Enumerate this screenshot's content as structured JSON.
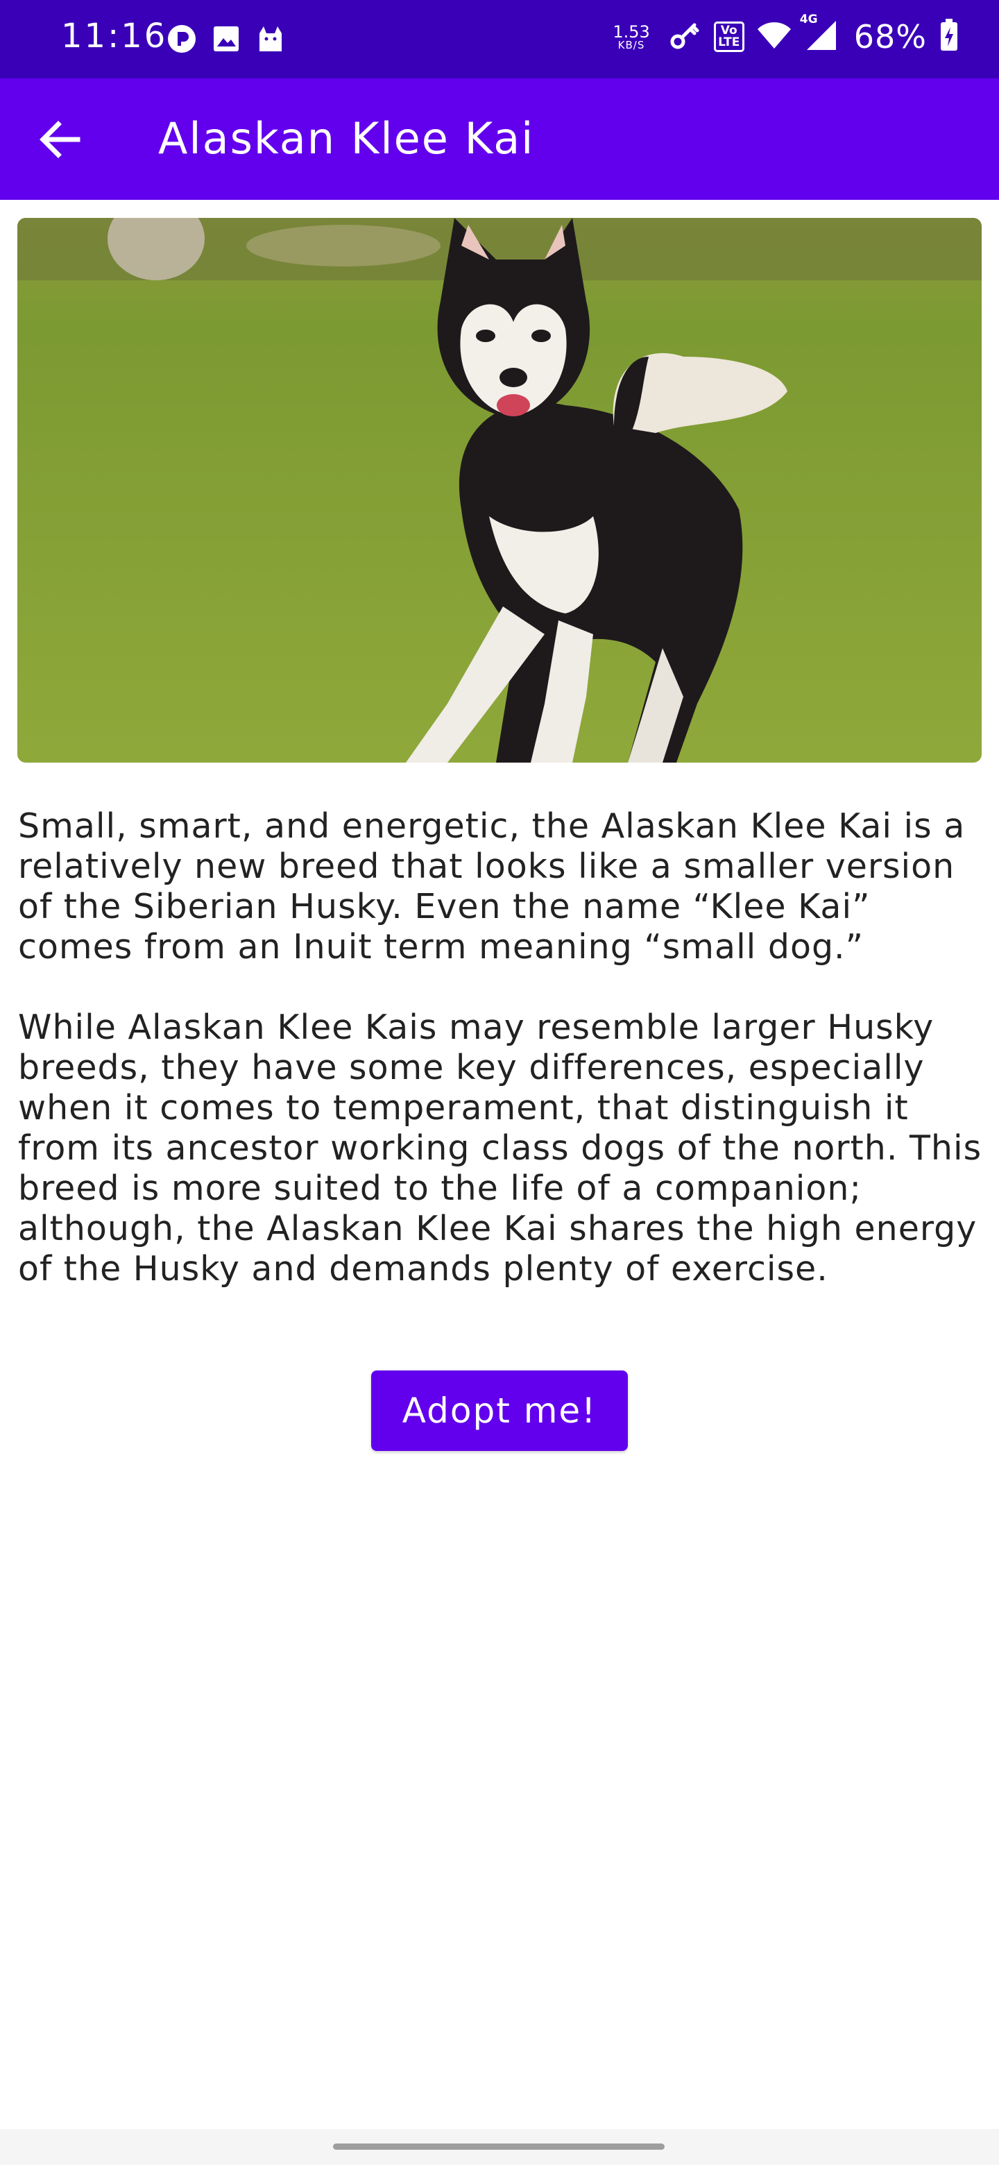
{
  "status_bar": {
    "time": "11:16",
    "network_speed_value": "1.53",
    "network_speed_unit": "KB/S",
    "volte_label": "Vo LTE",
    "network_type": "4G",
    "battery": "68%",
    "left_icons": [
      "notification-app-icon",
      "image-icon",
      "cat-app-icon"
    ],
    "right_icons": [
      "key-icon",
      "volte-icon",
      "wifi-icon",
      "signal-icon",
      "battery-charging-icon"
    ]
  },
  "app_bar": {
    "title": "Alaskan Klee Kai",
    "back_icon": "arrow-back-icon",
    "color": "#6200ee"
  },
  "content": {
    "paragraphs": [
      "Small, smart, and energetic, the Alaskan Klee Kai is a relatively new breed that looks like a smaller version of the Siberian Husky. Even the name “Klee Kai” comes from an Inuit term meaning “small dog.”",
      "While Alaskan Klee Kais may resemble larger Husky breeds, they have some key differences, especially when it comes to temperament, that distinguish it from its ancestor working class dogs of the north. This breed is more suited to the life of a companion; although, the Alaskan Klee Kai shares the high energy of the Husky and demands plenty of exercise."
    ],
    "button_label": "Adopt me!"
  },
  "colors": {
    "status_bar": "#3a00b8",
    "primary": "#6200ee",
    "text": "#222222"
  }
}
